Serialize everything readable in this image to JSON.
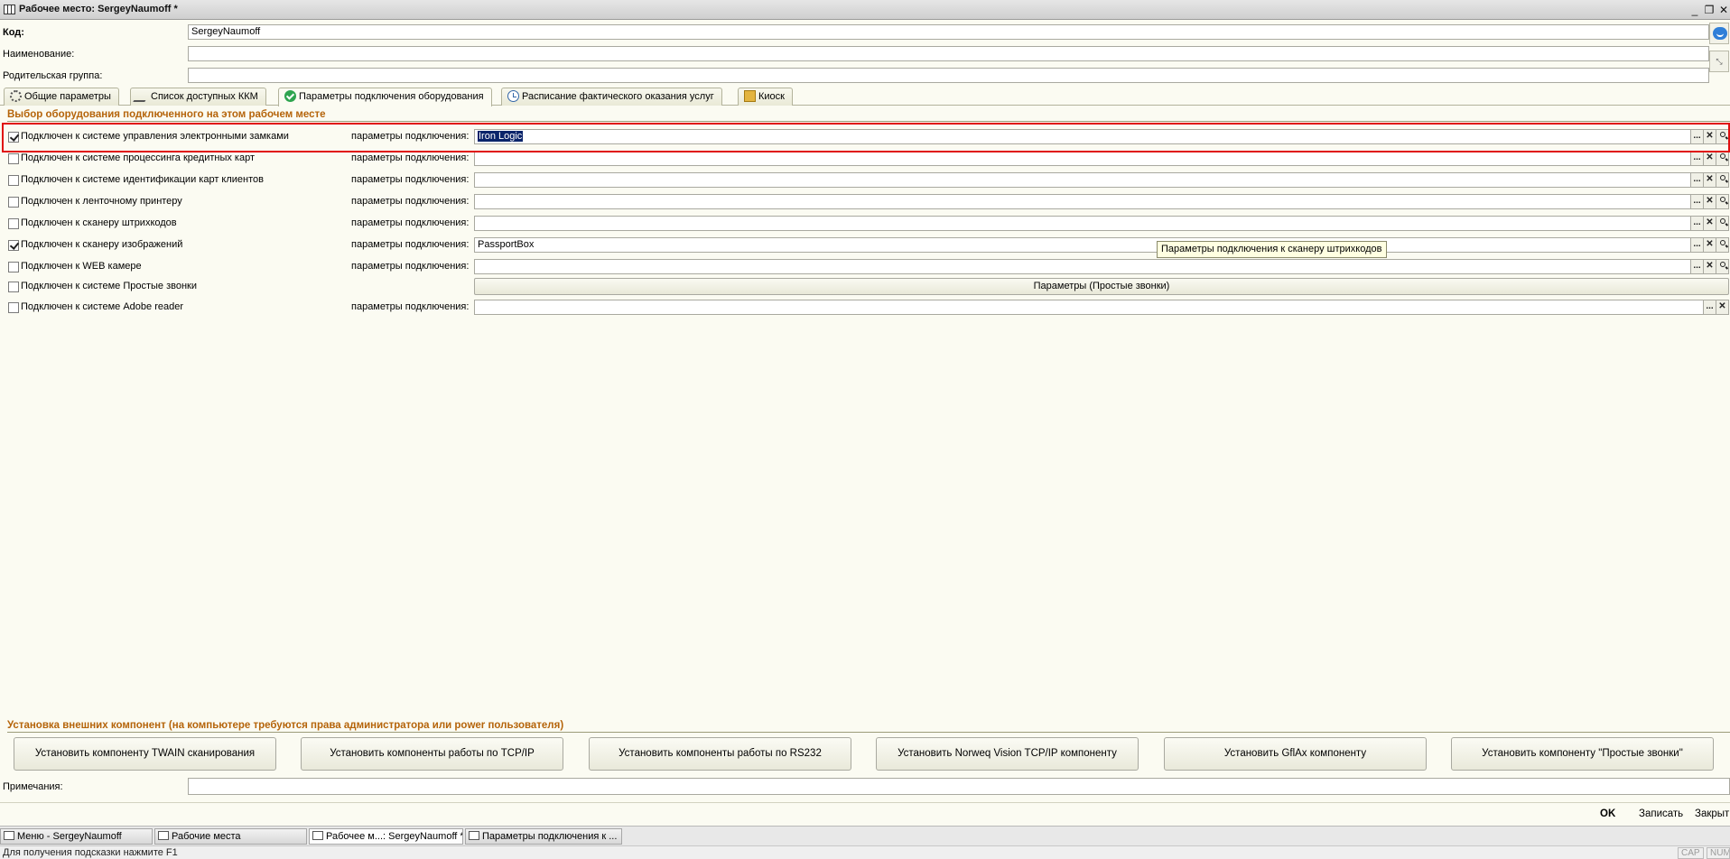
{
  "window": {
    "title": "Рабочее место: SergeyNaumoff *",
    "controls": {
      "minimize": "_",
      "restore": "❐",
      "close": "✕"
    }
  },
  "header": {
    "code_label": "Код:",
    "code_value": "SergeyNaumoff",
    "name_label": "Наименование:",
    "name_value": "",
    "parent_label": "Родительская группа:",
    "parent_value": ""
  },
  "tabs": [
    {
      "label": "Общие параметры",
      "icon": "gear-icon"
    },
    {
      "label": "Список доступных ККМ",
      "icon": "pen-icon"
    },
    {
      "label": "Параметры подключения оборудования",
      "icon": "check-icon",
      "active": true
    },
    {
      "label": "Расписание фактического оказания услуг",
      "icon": "clock-icon"
    },
    {
      "label": "Киоск",
      "icon": "kiosk-icon"
    }
  ],
  "equipment": {
    "group_title": "Выбор оборудования подключенного на этом рабочем месте",
    "param_label": "параметры подключения:",
    "rows": [
      {
        "label": "Подключен к системе управления электронными замками",
        "checked": true,
        "value": "Iron Logic"
      },
      {
        "label": "Подключен к системе процессинга кредитных карт",
        "checked": false,
        "value": ""
      },
      {
        "label": "Подключен к системе идентификации карт клиентов",
        "checked": false,
        "value": ""
      },
      {
        "label": "Подключен к ленточному принтеру",
        "checked": false,
        "value": ""
      },
      {
        "label": "Подключен к сканеру штрихкодов",
        "checked": false,
        "value": ""
      },
      {
        "label": "Подключен к сканеру изображений",
        "checked": true,
        "value": "PassportBox"
      },
      {
        "label": "Подключен к WEB камере",
        "checked": false,
        "value": ""
      },
      {
        "label": "Подключен к системе Простые звонки",
        "checked": false,
        "button": "Параметры (Простые звонки)"
      },
      {
        "label": "Подключен к системе Adobe reader",
        "checked": false,
        "value": ""
      }
    ],
    "field_buttons": {
      "select": "...",
      "clear": "✕"
    },
    "tooltip": "Параметры подключения к сканеру штрихкодов"
  },
  "install": {
    "group_title": "Установка внешних компонент (на компьютере требуются права администратора или power пользователя)",
    "buttons": [
      "Установить компоненту TWAIN сканирования",
      "Установить компоненты работы по TCP/IP",
      "Установить компоненты работы по RS232",
      "Установить Norweq Vision TCP/IP компоненту",
      "Установить GflAx компоненту",
      "Установить компоненту \"Простые звонки\""
    ]
  },
  "notes": {
    "label": "Примечания:",
    "value": ""
  },
  "actions": {
    "ok": "OK",
    "save": "Записать",
    "close": "Закрыть"
  },
  "taskbar": [
    "Меню - SergeyNaumoff",
    "Рабочие места",
    "Рабочее м...: SergeyNaumoff *",
    "Параметры подключения к ..."
  ],
  "status": {
    "hint": "Для получения подсказки нажмите F1",
    "cap": "CAP",
    "num": "NUM"
  }
}
